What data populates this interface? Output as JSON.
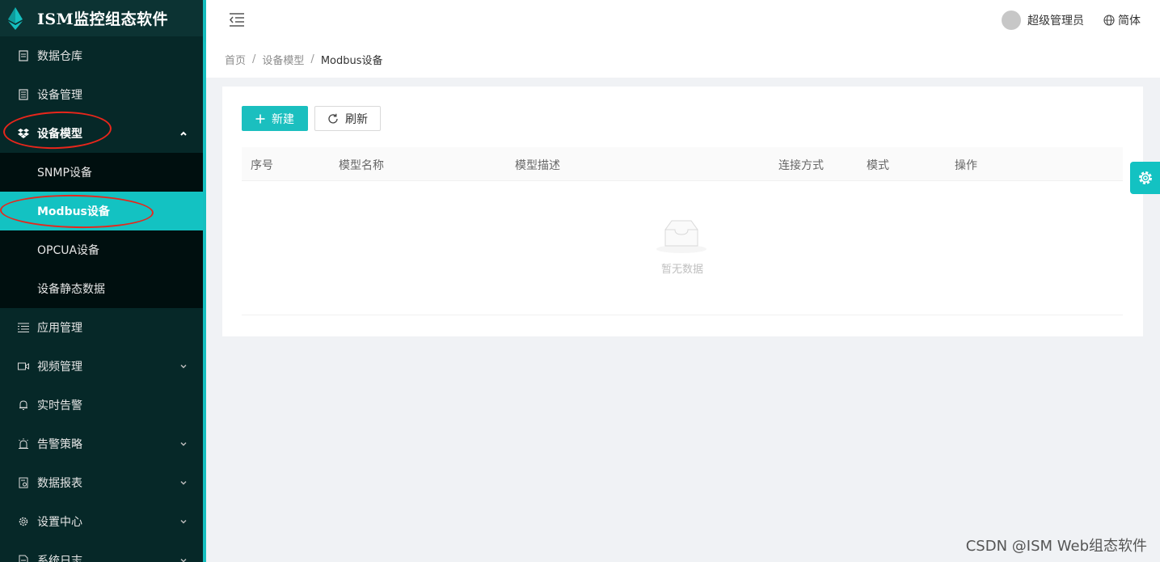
{
  "app": {
    "title": "ISM监控组态软件"
  },
  "sidebar": {
    "items": [
      {
        "label": "数据仓库",
        "icon": "document-icon",
        "expandable": false
      },
      {
        "label": "设备管理",
        "icon": "document-icon",
        "expandable": false
      },
      {
        "label": "设备模型",
        "icon": "dropbox-icon",
        "expandable": true,
        "open": true,
        "children": [
          {
            "label": "SNMP设备",
            "active": false
          },
          {
            "label": "Modbus设备",
            "active": true
          },
          {
            "label": "OPCUA设备",
            "active": false
          },
          {
            "label": "设备静态数据",
            "active": false
          }
        ]
      },
      {
        "label": "应用管理",
        "icon": "list-icon",
        "expandable": false
      },
      {
        "label": "视频管理",
        "icon": "video-icon",
        "expandable": true
      },
      {
        "label": "实时告警",
        "icon": "bell-icon",
        "expandable": false
      },
      {
        "label": "告警策略",
        "icon": "alarm-light-icon",
        "expandable": true
      },
      {
        "label": "数据报表",
        "icon": "report-icon",
        "expandable": true
      },
      {
        "label": "设置中心",
        "icon": "gear-icon",
        "expandable": true
      },
      {
        "label": "系统日志",
        "icon": "file-icon",
        "expandable": true
      }
    ]
  },
  "header": {
    "user_name": "超级管理员",
    "language": "简体"
  },
  "breadcrumb": [
    "首页",
    "设备模型",
    "Modbus设备"
  ],
  "toolbar": {
    "new_label": "新建",
    "refresh_label": "刷新"
  },
  "table": {
    "columns": [
      "序号",
      "模型名称",
      "模型描述",
      "连接方式",
      "模式",
      "操作"
    ],
    "rows": [],
    "empty_text": "暂无数据"
  },
  "watermark": "CSDN @ISM Web组态软件",
  "colors": {
    "accent": "#13c2c2",
    "sidebar_bg": "#062828",
    "annotation": "#e8261b"
  }
}
